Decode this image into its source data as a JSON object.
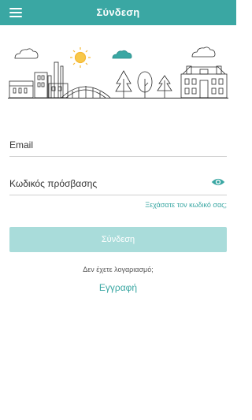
{
  "appbar": {
    "title": "Σύνδεση",
    "menu_icon": "hamburger-menu-icon",
    "background_color": "#3aa7a3"
  },
  "illustration": {
    "description_icon": "town-landscape-illustration",
    "accent_color": "#3aa7a3",
    "sun_color": "#f5b630"
  },
  "form": {
    "email_placeholder": "Email",
    "email_value": "",
    "password_placeholder": "Κωδικός πρόσβασης",
    "password_value": "",
    "show_password_icon": "eye-icon",
    "forgot_password_label": "Ξεχάσατε τον κωδικό σας;",
    "login_button_label": "Σύνδεση",
    "login_button_color": "#a9dcda"
  },
  "footer": {
    "no_account_text": "Δεν έχετε λογαριασμό;",
    "register_label": "Εγγραφή",
    "link_color": "#3aa7a3"
  }
}
